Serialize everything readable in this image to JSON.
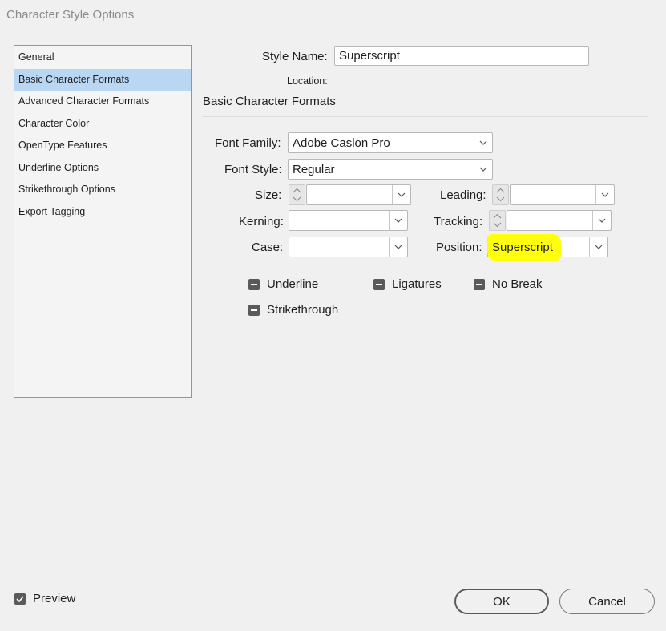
{
  "window": {
    "title": "Character Style Options"
  },
  "panels": [
    {
      "label": "General"
    },
    {
      "label": "Basic Character Formats",
      "selected": true
    },
    {
      "label": "Advanced Character Formats"
    },
    {
      "label": "Character Color"
    },
    {
      "label": "OpenType Features"
    },
    {
      "label": "Underline Options"
    },
    {
      "label": "Strikethrough Options"
    },
    {
      "label": "Export Tagging"
    }
  ],
  "style_name": {
    "label": "Style Name:",
    "value": "Superscript"
  },
  "location": {
    "label": "Location:"
  },
  "section": {
    "title": "Basic Character Formats"
  },
  "fields": {
    "font_family": {
      "label": "Font Family:",
      "value": "Adobe Caslon Pro"
    },
    "font_style": {
      "label": "Font Style:",
      "value": "Regular"
    },
    "size": {
      "label": "Size:",
      "value": ""
    },
    "leading": {
      "label": "Leading:",
      "value": ""
    },
    "kerning": {
      "label": "Kerning:",
      "value": ""
    },
    "tracking": {
      "label": "Tracking:",
      "value": ""
    },
    "case": {
      "label": "Case:",
      "value": ""
    },
    "position": {
      "label": "Position:",
      "value": "Superscript"
    }
  },
  "checkboxes": {
    "underline": {
      "label": "Underline",
      "state": "mixed"
    },
    "ligatures": {
      "label": "Ligatures",
      "state": "mixed"
    },
    "no_break": {
      "label": "No Break",
      "state": "mixed"
    },
    "strikethrough": {
      "label": "Strikethrough",
      "state": "mixed"
    }
  },
  "preview": {
    "label": "Preview",
    "checked": true
  },
  "buttons": {
    "ok": "OK",
    "cancel": "Cancel"
  },
  "colors": {
    "selection": "#b9d6f3",
    "highlight": "#ffff00",
    "panel_border": "#6b9ed6"
  }
}
